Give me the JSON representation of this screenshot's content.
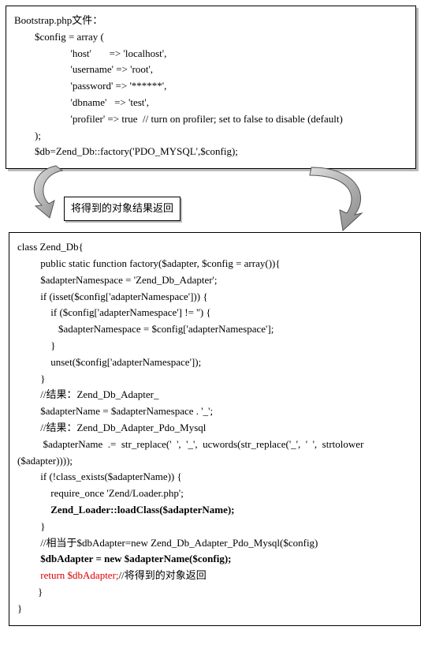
{
  "top_box": {
    "line1": "Bootstrap.php文件：",
    "line2": "        $config = array (",
    "line3": "                      'host'       => 'localhost',",
    "line4": "                      'username' => 'root',",
    "line5": "                      'password' => '******',",
    "line6": "                      'dbname'   => 'test',",
    "line7": "                      'profiler' => true  // turn on profiler; set to false to disable (default)",
    "line8": "        );",
    "line9": "        $db=Zend_Db::factory('PDO_MYSQL',$config);"
  },
  "mid_label": "将得到的对象结果返回",
  "bottom_box": {
    "l1": "class Zend_Db{",
    "l2": "",
    "l3": "         public static function factory($adapter, $config = array()){",
    "l4": "",
    "l5": "         $adapterNamespace = 'Zend_Db_Adapter';",
    "l6": "         if (isset($config['adapterNamespace'])) {",
    "l7": "             if ($config['adapterNamespace'] != '') {",
    "l8": "                $adapterNamespace = $config['adapterNamespace'];",
    "l9": "             }",
    "l10": "             unset($config['adapterNamespace']);",
    "l11": "         }",
    "l12": "         //结果：Zend_Db_Adapter_",
    "l13": "         $adapterName = $adapterNamespace . '_';",
    "l14": "         //结果：Zend_Db_Adapter_Pdo_Mysql",
    "l15": "          $adapterName  .=  str_replace('  ',  '_',  ucwords(str_replace('_',  '  ',  strtolower",
    "l15b": "($adapter))));",
    "l16": "         if (!class_exists($adapterName)) {",
    "l17": "             require_once 'Zend/Loader.php';",
    "l18": "             Zend_Loader::loadClass($adapterName);",
    "l19": "         }",
    "l20": "         //相当于$dbAdapter=new Zend_Db_Adapter_Pdo_Mysql($config)",
    "l21": "         $dbAdapter = new $adapterName($config);",
    "l22a": "         return $dbAdapter;",
    "l22b": "//将得到的对象返回",
    "l23": "        }",
    "l24": "}"
  }
}
